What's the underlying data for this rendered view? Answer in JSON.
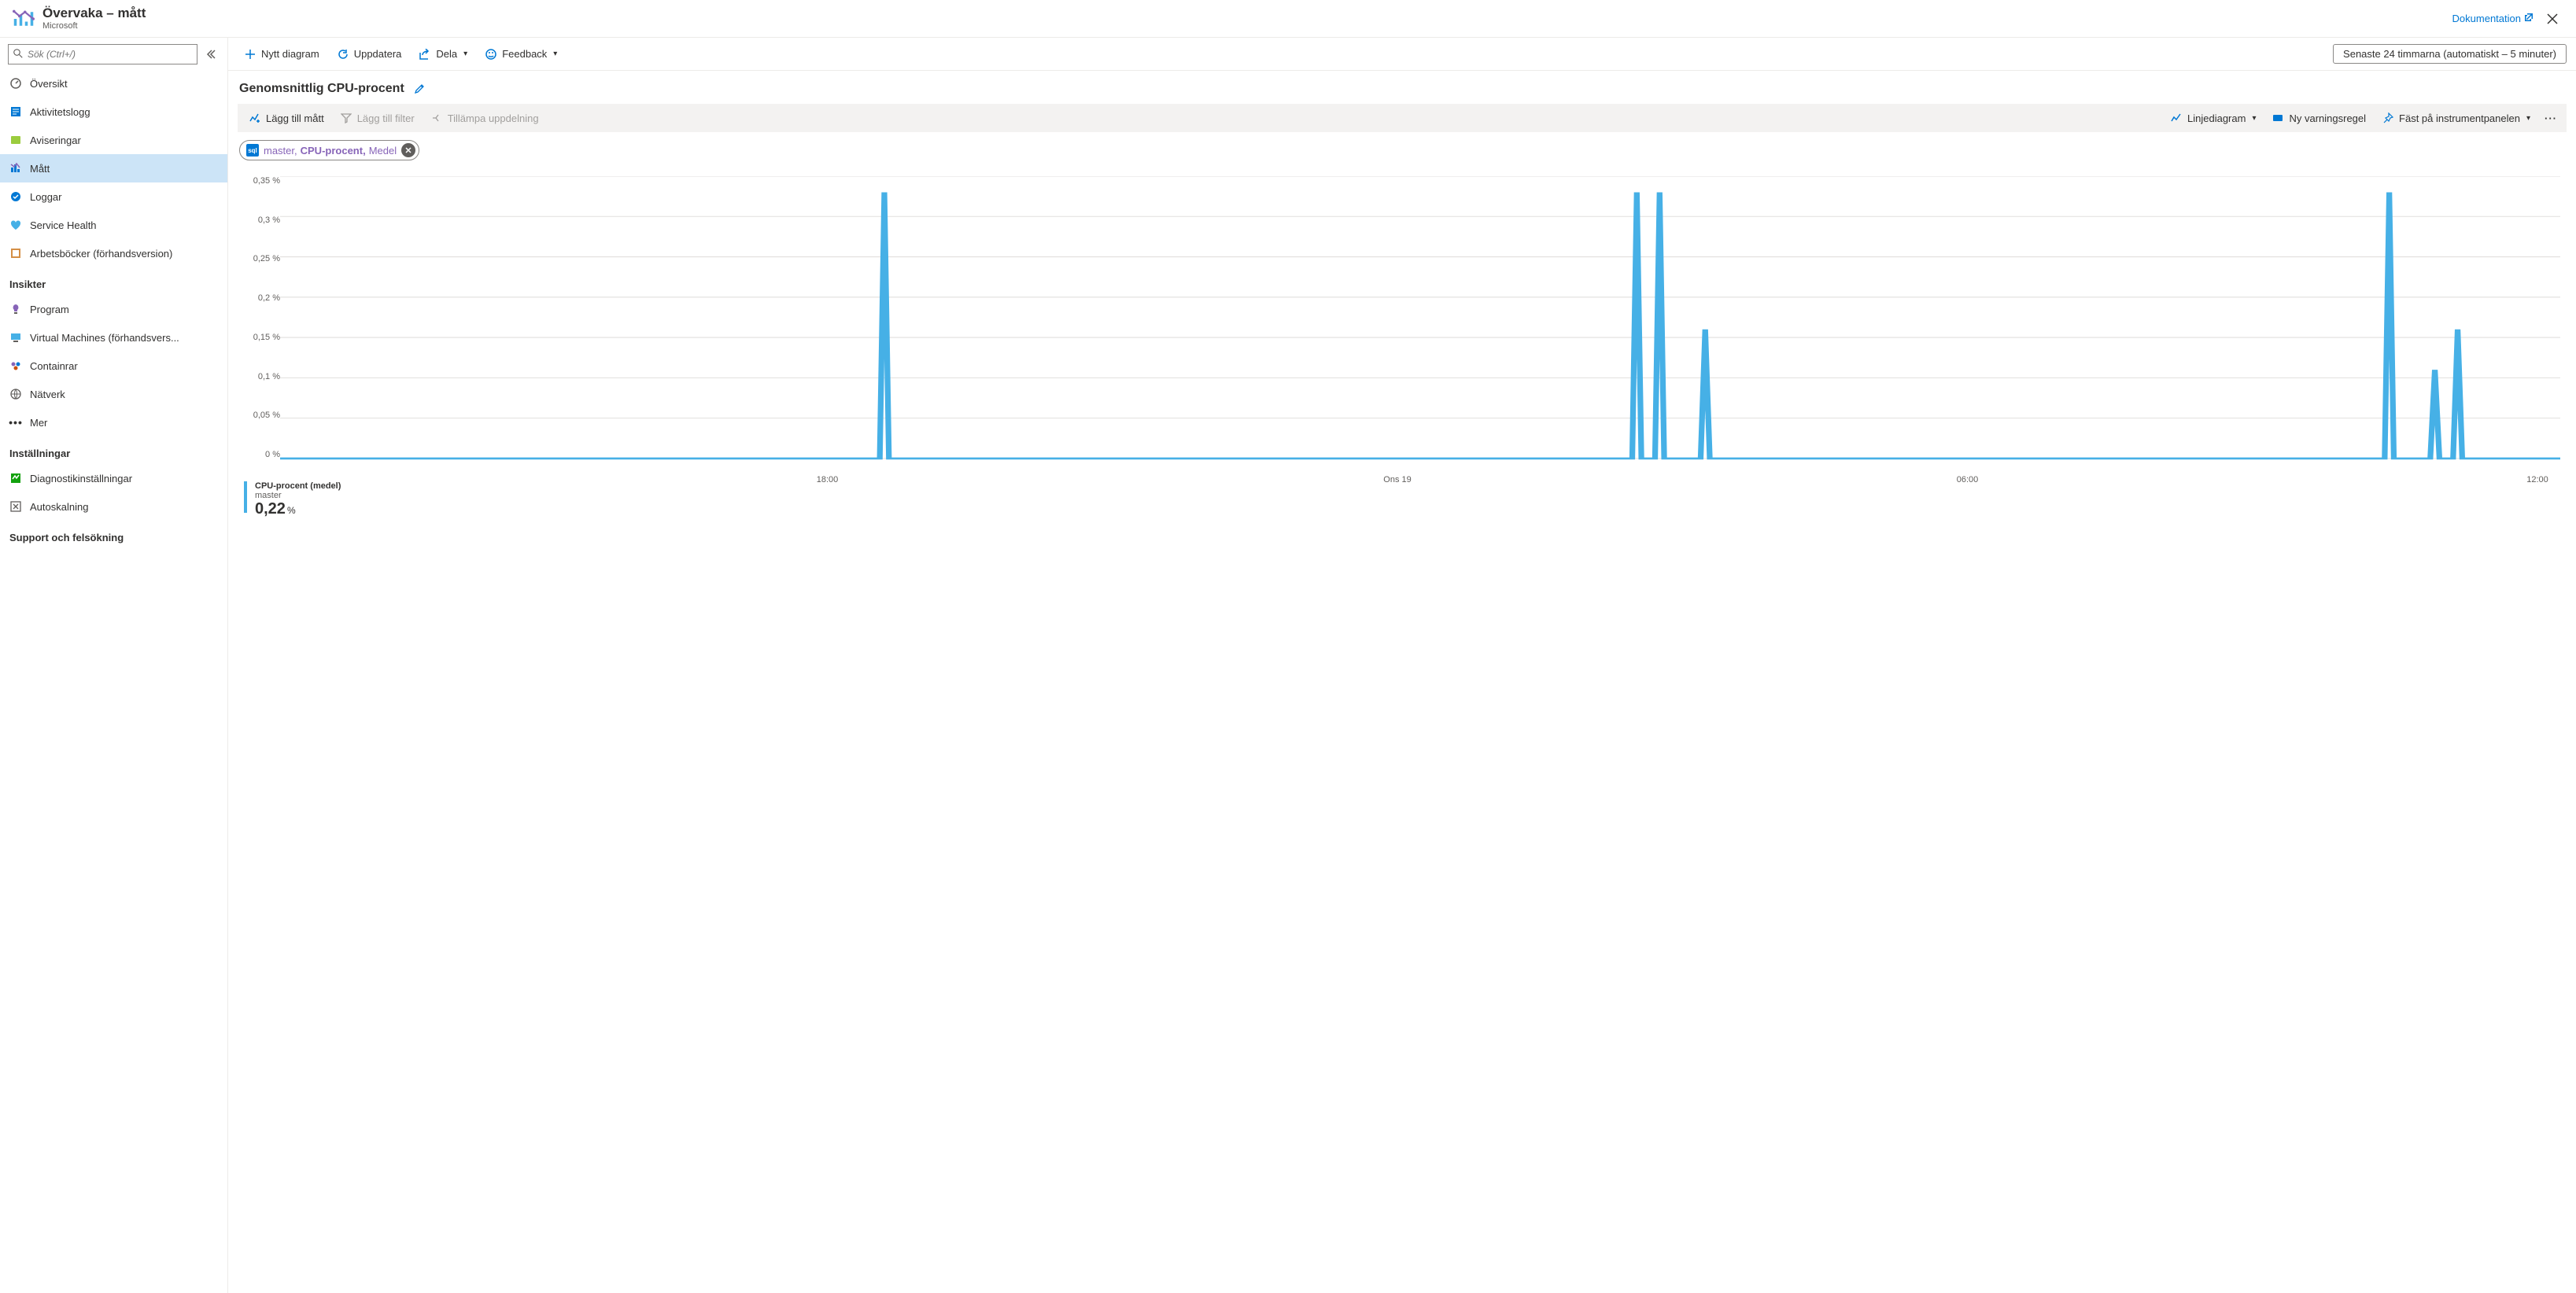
{
  "header": {
    "title": "Övervaka – mått",
    "subtitle": "Microsoft",
    "doc_link": "Dokumentation"
  },
  "sidebar": {
    "search_placeholder": "Sök (Ctrl+/)",
    "items": [
      {
        "label": "Översikt",
        "icon": "gauge",
        "selected": false
      },
      {
        "label": "Aktivitetslogg",
        "icon": "log",
        "selected": false
      },
      {
        "label": "Aviseringar",
        "icon": "alert",
        "selected": false
      },
      {
        "label": "Mått",
        "icon": "metrics",
        "selected": true
      },
      {
        "label": "Loggar",
        "icon": "logs",
        "selected": false
      },
      {
        "label": "Service Health",
        "icon": "health",
        "selected": false
      },
      {
        "label": "Arbetsböcker (förhandsversion)",
        "icon": "workbook",
        "selected": false
      }
    ],
    "sections": [
      {
        "title": "Insikter",
        "items": [
          {
            "label": "Program",
            "icon": "bulb"
          },
          {
            "label": "Virtual Machines (förhandsvers...",
            "icon": "vm"
          },
          {
            "label": "Containrar",
            "icon": "container"
          },
          {
            "label": "Nätverk",
            "icon": "network"
          },
          {
            "label": "Mer",
            "icon": "more"
          }
        ]
      },
      {
        "title": "Inställningar",
        "items": [
          {
            "label": "Diagnostikinställningar",
            "icon": "diag"
          },
          {
            "label": "Autoskalning",
            "icon": "autoscale"
          }
        ]
      },
      {
        "title": "Support och felsökning",
        "items": []
      }
    ]
  },
  "toolbar1": {
    "new_chart": "Nytt diagram",
    "refresh": "Uppdatera",
    "share": "Dela",
    "feedback": "Feedback",
    "time_range": "Senaste 24 timmarna (automatiskt – 5 minuter)"
  },
  "chart_header": {
    "title": "Genomsnittlig CPU-procent"
  },
  "toolbar2": {
    "add_metric": "Lägg till mått",
    "add_filter": "Lägg till filter",
    "apply_splitting": "Tillämpa uppdelning",
    "chart_type": "Linjediagram",
    "new_alert": "Ny varningsregel",
    "pin": "Fäst på instrumentpanelen"
  },
  "metric_chip": {
    "resource": "master,",
    "metric": "CPU-procent,",
    "aggregation": "Medel"
  },
  "chart_data": {
    "type": "line",
    "title": "Genomsnittlig CPU-procent",
    "ylabel": "",
    "ylim": [
      0,
      0.35
    ],
    "y_ticks": [
      "0,35 %",
      "0,3 %",
      "0,25 %",
      "0,2 %",
      "0,15 %",
      "0,1 %",
      "0,05 %",
      "0 %"
    ],
    "x_ticks": [
      {
        "pos": 0.24,
        "label": "18:00"
      },
      {
        "pos": 0.49,
        "label": "Ons 19"
      },
      {
        "pos": 0.74,
        "label": "06:00"
      },
      {
        "pos": 0.99,
        "label": "12:00"
      }
    ],
    "series": [
      {
        "name": "CPU-procent (medel)",
        "resource": "master",
        "spikes": [
          {
            "pos": 0.265,
            "value": 0.33
          },
          {
            "pos": 0.595,
            "value": 0.33
          },
          {
            "pos": 0.605,
            "value": 0.33
          },
          {
            "pos": 0.625,
            "value": 0.16
          },
          {
            "pos": 0.925,
            "value": 0.33
          },
          {
            "pos": 0.945,
            "value": 0.11
          },
          {
            "pos": 0.955,
            "value": 0.16
          }
        ]
      }
    ]
  },
  "legend": {
    "label": "CPU-procent (medel)",
    "resource": "master",
    "value": "0,22",
    "unit": "%"
  }
}
